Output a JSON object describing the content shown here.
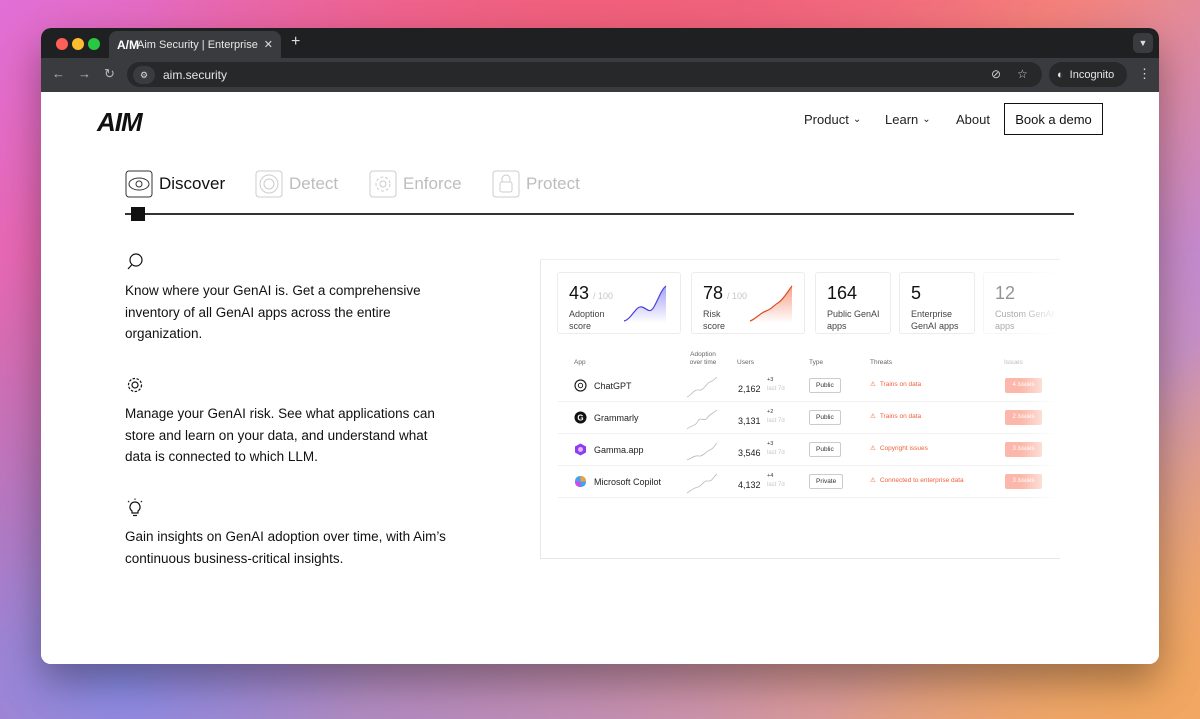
{
  "browser": {
    "tab_title": "Aim Security | Enterprise-grade",
    "tab_logo": "A/M",
    "url": "aim.security",
    "incognito_label": "Incognito"
  },
  "header": {
    "logo": "AIM",
    "nav": [
      {
        "label": "Product",
        "has_dropdown": true
      },
      {
        "label": "Learn",
        "has_dropdown": true
      },
      {
        "label": "About",
        "has_dropdown": false
      }
    ],
    "cta": "Book a demo"
  },
  "steps": [
    {
      "label": "Discover",
      "icon": "eye-icon",
      "active": true
    },
    {
      "label": "Detect",
      "icon": "radar-icon",
      "active": false
    },
    {
      "label": "Enforce",
      "icon": "gear-icon",
      "active": false
    },
    {
      "label": "Protect",
      "icon": "lock-icon",
      "active": false
    }
  ],
  "features": [
    {
      "icon": "search-icon",
      "text": "Know where your GenAI is. Get a comprehensive inventory of all GenAI apps across the entire organization."
    },
    {
      "icon": "gear-icon",
      "text": "Manage your GenAI risk. See what applications can store and learn on your data, and understand what data is connected to which LLM."
    },
    {
      "icon": "lightbulb-icon",
      "text": "Gain insights on GenAI adoption over time, with Aim’s continuous business-critical insights."
    }
  ],
  "dashboard": {
    "cards": [
      {
        "value": "43",
        "of": "/ 100",
        "label": "Adoption score"
      },
      {
        "value": "78",
        "of": "/ 100",
        "label": "Risk score"
      },
      {
        "value": "164",
        "of": "",
        "label": "Public GenAI apps"
      },
      {
        "value": "5",
        "of": "",
        "label": "Enterprise GenAI apps"
      },
      {
        "value": "12",
        "of": "",
        "label": "Custom GenAI apps"
      }
    ],
    "columns": [
      "App",
      "Adoption over time",
      "Users",
      "Type",
      "Threats",
      "Issues"
    ],
    "rows": [
      {
        "app": "ChatGPT",
        "users": "2,162",
        "delta": "+3",
        "period": "last 7d",
        "type": "Public",
        "threat": "Trains on data",
        "issues": "4 issues"
      },
      {
        "app": "Grammarly",
        "users": "3,131",
        "delta": "+2",
        "period": "last 7d",
        "type": "Public",
        "threat": "Trains on data",
        "issues": "2 issues"
      },
      {
        "app": "Gamma.app",
        "users": "3,546",
        "delta": "+3",
        "period": "last 7d",
        "type": "Public",
        "threat": "Copyright issues",
        "issues": "3 issues"
      },
      {
        "app": "Microsoft Copilot",
        "users": "4,132",
        "delta": "+4",
        "period": "last 7d",
        "type": "Private",
        "threat": "Connected to enterprise data",
        "issues": "3 issues"
      }
    ]
  },
  "colors": {
    "accent_orange": "#f0613a",
    "accent_purple": "#6a63f0",
    "dark": "#111111"
  }
}
